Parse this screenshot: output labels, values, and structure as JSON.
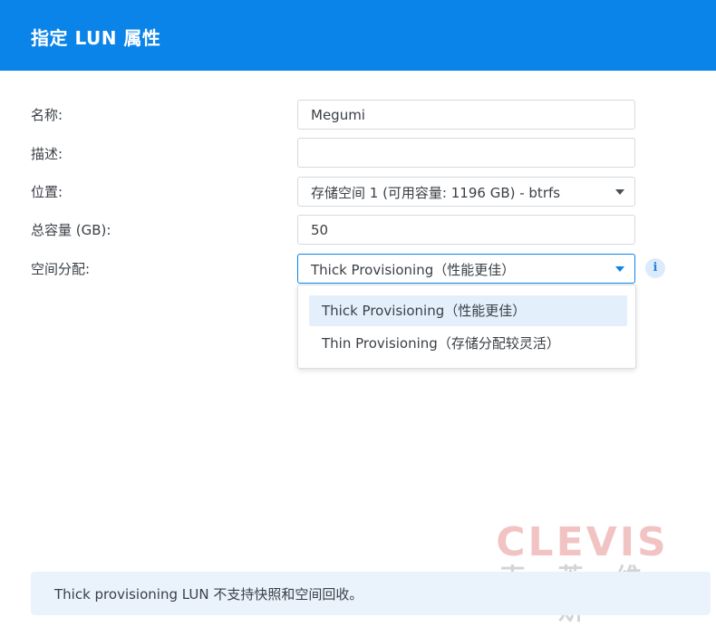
{
  "dialog": {
    "title": "指定 LUN 属性"
  },
  "form": {
    "name_label": "名称:",
    "name_value": "Megumi",
    "description_label": "描述:",
    "description_value": "",
    "location_label": "位置:",
    "location_value": "存储空间 1 (可用容量: 1196 GB) - btrfs",
    "capacity_label": "总容量 (GB):",
    "capacity_value": "50",
    "allocation_label": "空间分配:",
    "allocation_value": "Thick Provisioning（性能更佳）"
  },
  "dropdown": {
    "options": [
      "Thick Provisioning（性能更佳）",
      "Thin Provisioning（存储分配较灵活）"
    ],
    "selected_index": 0
  },
  "info_icon": {
    "glyph": "i"
  },
  "footer": {
    "note": "Thick provisioning LUN 不支持快照和空间回收。"
  },
  "watermark": {
    "logo": "CLEVIS",
    "subtitle": "克莱维斯"
  },
  "colors": {
    "header": "#0a84e8",
    "accent": "#0a84e8",
    "selected_option": "#e3f0fc",
    "footer_bg": "#eaf3fc"
  }
}
